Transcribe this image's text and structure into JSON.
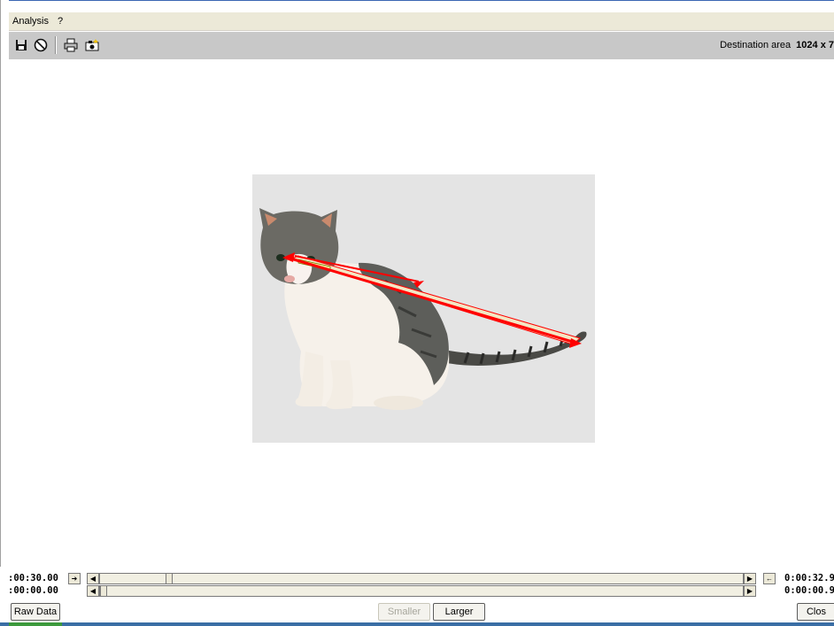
{
  "menu": {
    "items": [
      "Analysis",
      "?"
    ]
  },
  "toolbar": {
    "icons": [
      "save-icon",
      "clock-icon",
      "print-icon",
      "camera-icon"
    ],
    "destination_label": "Destination area",
    "destination_value": "1024 x 7"
  },
  "timeline": {
    "row1_start": ":00:30.00",
    "row1_end": "0:00:32.9",
    "row2_start": ":00:00.00",
    "row2_end": "0:00:00.9"
  },
  "buttons": {
    "raw_data": "Raw Data",
    "smaller": "Smaller",
    "larger": "Larger",
    "close": "Clos"
  },
  "colors": {
    "arrow": "#ff0000",
    "measure_band": "#f3e7c4"
  }
}
